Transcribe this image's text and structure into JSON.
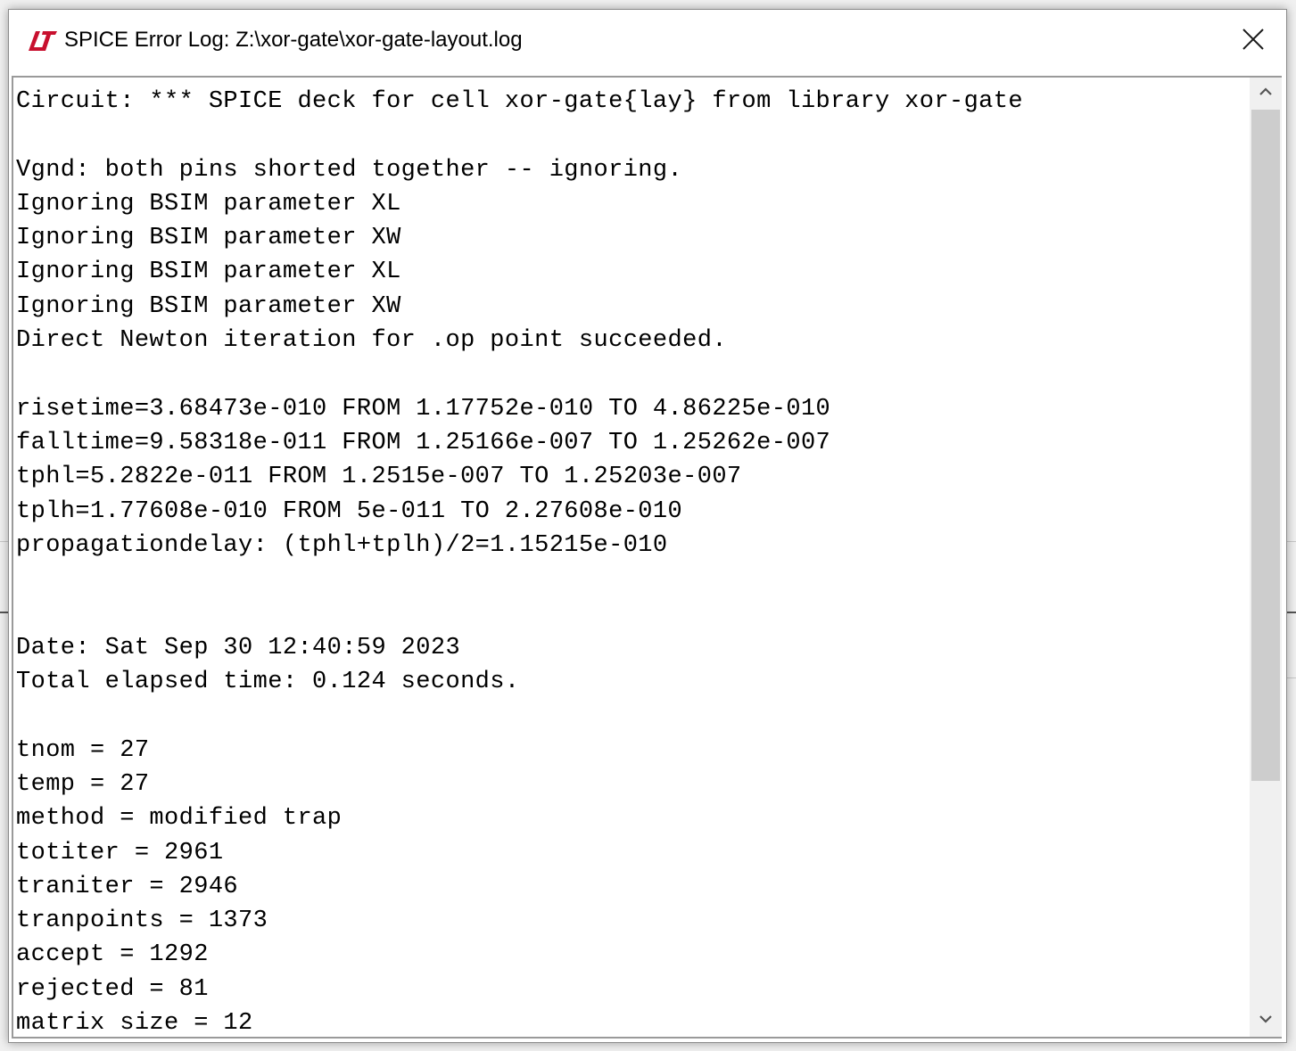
{
  "window": {
    "title": "SPICE Error Log: Z:\\xor-gate\\xor-gate-layout.log",
    "app_icon": "ltspice-logo-icon",
    "close_icon": "close-icon"
  },
  "log": {
    "lines": [
      "Circuit: *** SPICE deck for cell xor-gate{lay} from library xor-gate",
      "",
      "Vgnd: both pins shorted together -- ignoring.",
      "Ignoring BSIM parameter XL",
      "Ignoring BSIM parameter XW",
      "Ignoring BSIM parameter XL",
      "Ignoring BSIM parameter XW",
      "Direct Newton iteration for .op point succeeded.",
      "",
      "risetime=3.68473e-010 FROM 1.17752e-010 TO 4.86225e-010",
      "falltime=9.58318e-011 FROM 1.25166e-007 TO 1.25262e-007",
      "tphl=5.2822e-011 FROM 1.2515e-007 TO 1.25203e-007",
      "tplh=1.77608e-010 FROM 5e-011 TO 2.27608e-010",
      "propagationdelay: (tphl+tplh)/2=1.15215e-010",
      "",
      "",
      "Date: Sat Sep 30 12:40:59 2023",
      "Total elapsed time: 0.124 seconds.",
      "",
      "tnom = 27",
      "temp = 27",
      "method = modified trap",
      "totiter = 2961",
      "traniter = 2946",
      "tranpoints = 1373",
      "accept = 1292",
      "rejected = 81",
      "matrix size = 12"
    ]
  },
  "scrollbar": {
    "up_icon": "chevron-up-icon",
    "down_icon": "chevron-down-icon",
    "position_fraction": 0.0,
    "visible_fraction": 0.75
  },
  "colors": {
    "logo": "#c8102e",
    "thumb": "#cdcdcd",
    "track": "#f0f0f0"
  }
}
